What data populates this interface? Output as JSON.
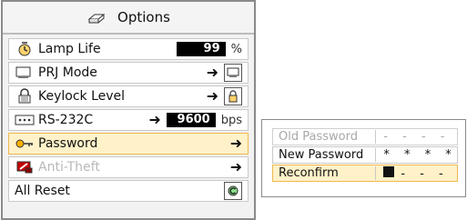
{
  "options_panel": {
    "title": "Options",
    "items": [
      {
        "label": "Lamp Life",
        "value": "99",
        "unit": "%"
      },
      {
        "label": "PRJ Mode",
        "arrow": "➜"
      },
      {
        "label": "Keylock Level",
        "arrow": "➜"
      },
      {
        "label": "RS-232C",
        "arrow": "➜",
        "value": "9600",
        "unit": "bps"
      },
      {
        "label": "Password",
        "arrow": "➜"
      },
      {
        "label": "Anti-Theft",
        "arrow": "➜"
      },
      {
        "label": "All Reset"
      }
    ]
  },
  "password_panel": {
    "rows": [
      {
        "label": "Old Password",
        "value": "- - - -"
      },
      {
        "label": "New Password",
        "value": "* * * *"
      },
      {
        "label": "Reconfirm",
        "value": "- - -"
      }
    ]
  },
  "colors": {
    "selected_fill": "#fff2c9",
    "selected_border": "#f0b74f",
    "disabled_text": "#b8b8b8"
  },
  "icons": {
    "title_icon": "options-icon",
    "lamp_life_icon": "lamp-timer-icon",
    "prj_mode_icon": "monitor-icon",
    "keylock_icon": "lock-icon",
    "rs232_icon": "serial-port-icon",
    "password_icon": "key-icon",
    "anti_theft_icon": "anti-theft-icon",
    "all_reset_icon": "reset-icon"
  }
}
